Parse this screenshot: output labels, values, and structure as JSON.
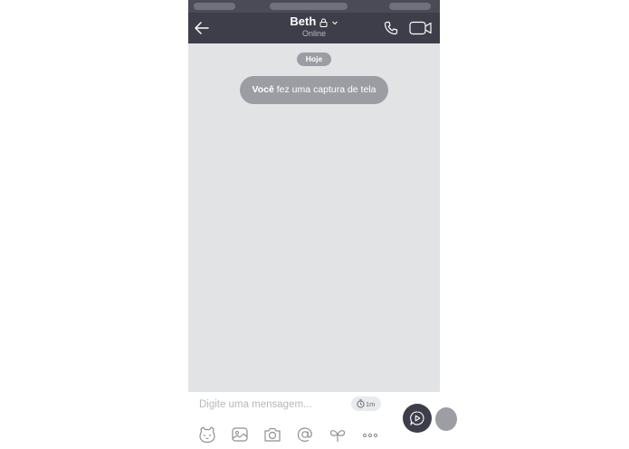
{
  "header": {
    "contact_name": "Beth",
    "status": "Online"
  },
  "chat": {
    "date_label": "Hoje",
    "system_message": {
      "actor": "Você",
      "text": "fez uma captura de tela"
    }
  },
  "composer": {
    "placeholder": "Digite uma mensagem...",
    "timer_label": "1m"
  },
  "icons": {
    "back": "arrow-left-icon",
    "lock": "lock-icon",
    "chevron": "chevron-down-icon",
    "call": "phone-icon",
    "video": "video-camera-icon",
    "timer": "clock-icon",
    "send": "send-play-icon",
    "toolbar": [
      "sticker-bear-icon",
      "gallery-icon",
      "camera-icon",
      "at-mention-icon",
      "doodle-icon",
      "more-dots-icon"
    ]
  },
  "colors": {
    "header_bg": "#3d3e4a",
    "chat_bg": "#e2e3e5",
    "pill_bg": "#9c9da3"
  }
}
